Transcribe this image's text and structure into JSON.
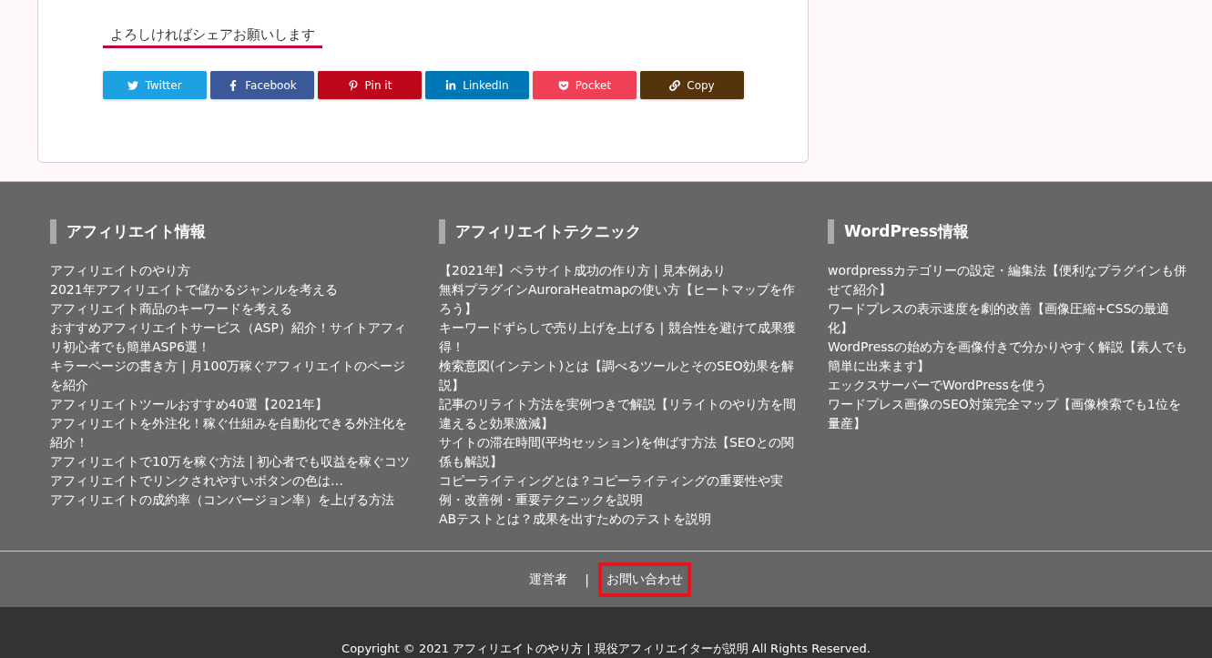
{
  "share": {
    "heading": "よろしければシェアお願いします",
    "buttons": [
      {
        "kind": "twitter",
        "label": "Twitter",
        "color": "#1da1e2"
      },
      {
        "kind": "facebook",
        "label": "Facebook",
        "color": "#3b5998"
      },
      {
        "kind": "pinterest",
        "label": "Pin it",
        "color": "#bd081c"
      },
      {
        "kind": "linkedin",
        "label": "LinkedIn",
        "color": "#0077b5"
      },
      {
        "kind": "pocket",
        "label": "Pocket",
        "color": "#ef4056"
      },
      {
        "kind": "copy",
        "label": "Copy",
        "color": "#55330c"
      }
    ]
  },
  "footer_columns": [
    {
      "title": "アフィリエイト情報",
      "links": [
        "アフィリエイトのやり方",
        "2021年アフィリエイトで儲かるジャンルを考える",
        "アフィリエイト商品のキーワードを考える",
        "おすすめアフィリエイトサービス（ASP）紹介！サイトアフィリ初心者でも簡単ASP6選！",
        "キラーページの書き方 | 月100万稼ぐアフィリエイトのページを紹介",
        "アフィリエイトツールおすすめ40選【2021年】",
        "アフィリエイトを外注化！稼ぐ仕組みを自動化できる外注化を紹介！",
        "アフィリエイトで10万を稼ぐ方法 | 初心者でも収益を稼ぐコツ",
        "アフィリエイトでリンクされやすいボタンの色は…",
        "アフィリエイトの成約率（コンバージョン率）を上げる方法"
      ]
    },
    {
      "title": "アフィリエイトテクニック",
      "links": [
        "【2021年】ペラサイト成功の作り方 | 見本例あり",
        "無料プラグインAuroraHeatmapの使い方【ヒートマップを作ろう】",
        "キーワードずらしで売り上げを上げる | 競合性を避けて成果獲得！",
        "検索意図(インテント)とは【調べるツールとそのSEO効果を解説】",
        "記事のリライト方法を実例つきで解説【リライトのやり方を間違えると効果激減】",
        "サイトの滞在時間(平均セッション)を伸ばす方法【SEOとの関係も解説】",
        "コピーライティングとは？コピーライティングの重要性や実例・改善例・重要テクニックを説明",
        "ABテストとは？成果を出すためのテストを説明"
      ]
    },
    {
      "title": "WordPress情報",
      "links": [
        "wordpressカテゴリーの設定・編集法【便利なプラグインも併せて紹介】",
        "ワードプレスの表示速度を劇的改善【画像圧縮+CSSの最適化】",
        "WordPressの始め方を画像付きで分かりやすく解説【素人でも簡単に出来ます】",
        "エックスサーバーでWordPressを使う",
        "ワードプレス画像のSEO対策完全マップ【画像検索でも1位を量産】"
      ]
    }
  ],
  "footer_nav": {
    "separator": "|",
    "links": [
      {
        "label": "運営者",
        "highlighted": false
      },
      {
        "label": "お問い合わせ",
        "highlighted": true
      }
    ]
  },
  "copyright": "Copyright © 2021 アフィリエイトのやり方 | 現役アフィリエイターが説明 All Rights Reserved."
}
